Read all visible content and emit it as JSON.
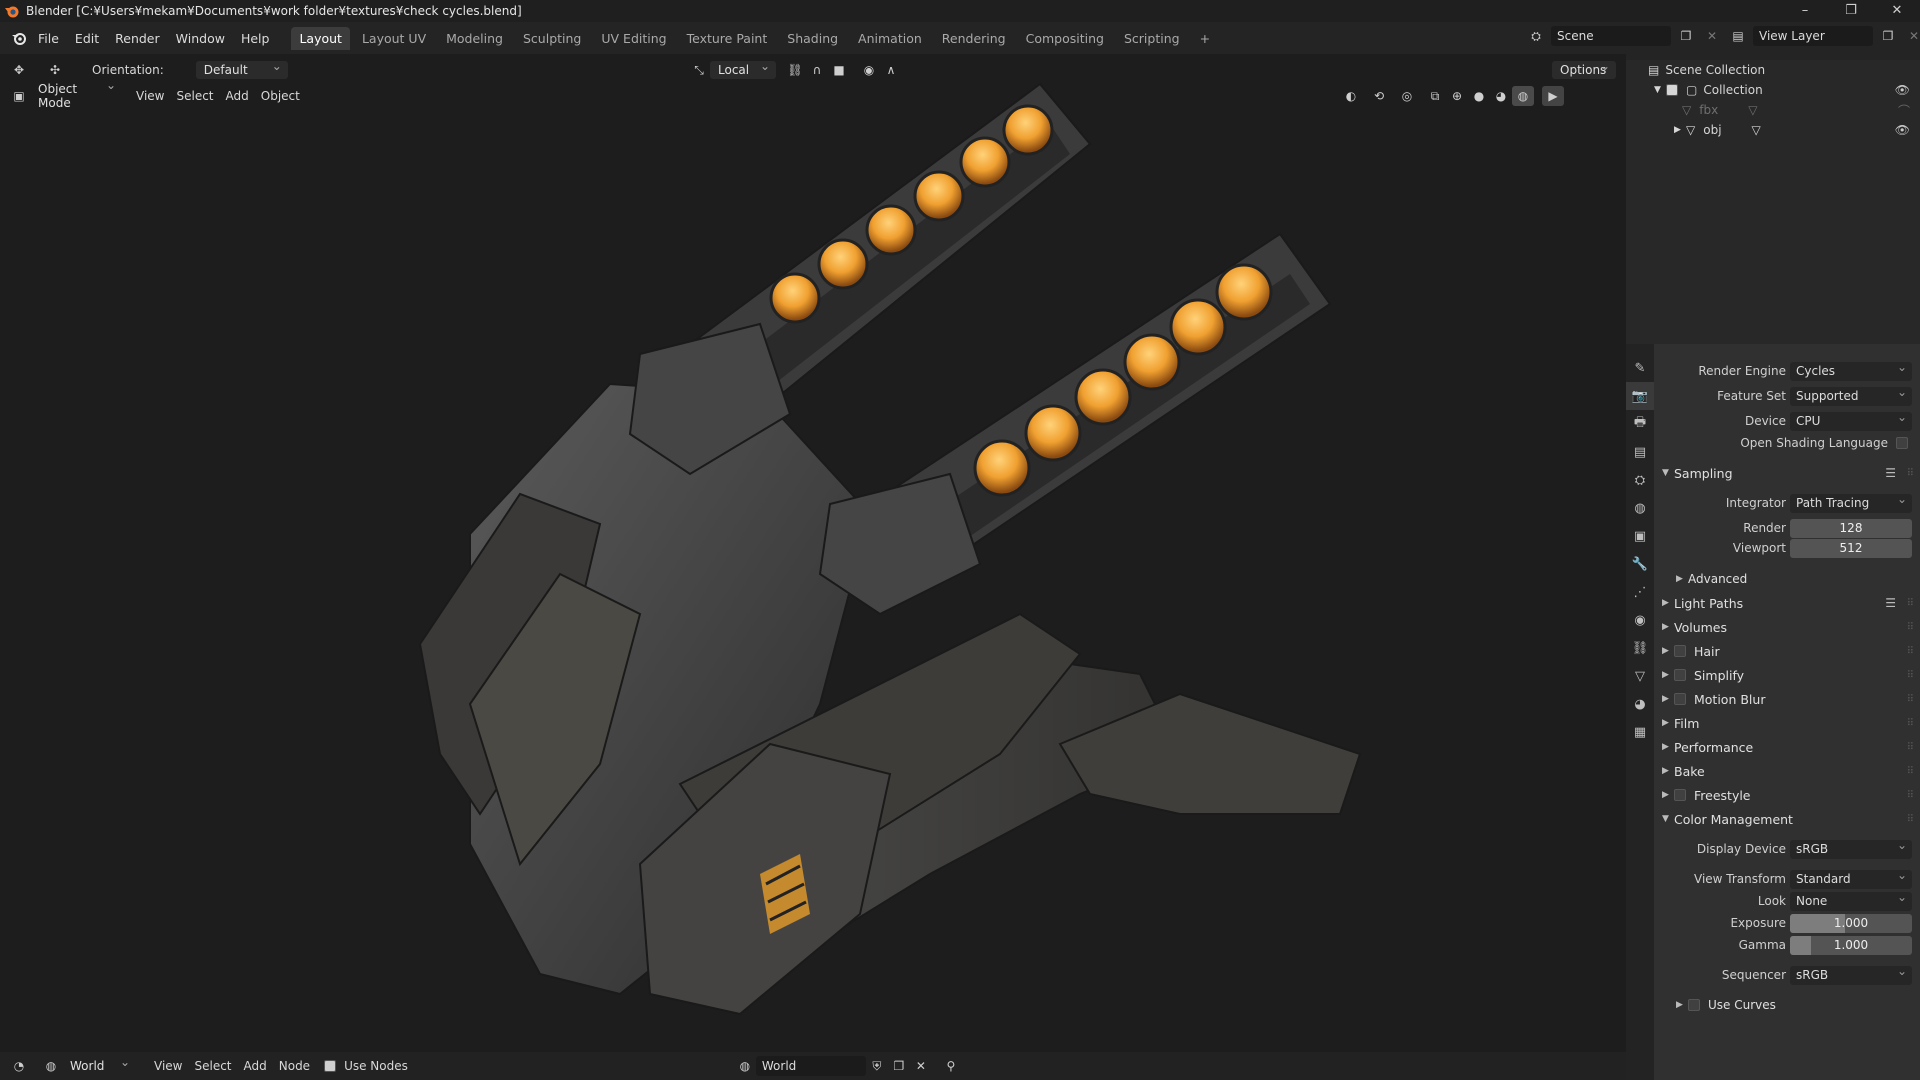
{
  "window": {
    "title": "Blender [C:¥Users¥mekam¥Documents¥work folder¥textures¥check cycles.blend]",
    "controls": [
      "–",
      "❐",
      "✕"
    ]
  },
  "menu": [
    "File",
    "Edit",
    "Render",
    "Window",
    "Help"
  ],
  "workspaces": [
    "Layout",
    "Layout UV",
    "Modeling",
    "Sculpting",
    "UV Editing",
    "Texture Paint",
    "Shading",
    "Animation",
    "Rendering",
    "Compositing",
    "Scripting",
    "+"
  ],
  "active_workspace": "Layout",
  "scene": {
    "name": "Scene",
    "view_layer": "View Layer"
  },
  "viewport_header": {
    "orientation_label": "Orientation:",
    "orientation_value": "Default",
    "pivot_value": "Local",
    "options": "Options",
    "mode": "Object Mode",
    "menus": [
      "View",
      "Select",
      "Add",
      "Object"
    ]
  },
  "outliner": {
    "root": "Scene Collection",
    "collection": "Collection",
    "items": [
      "fbx",
      "obj"
    ]
  },
  "properties": {
    "render_engine_label": "Render Engine",
    "render_engine": "Cycles",
    "feature_set_label": "Feature Set",
    "feature_set": "Supported",
    "device_label": "Device",
    "device": "CPU",
    "osl_label": "Open Shading Language",
    "sampling": "Sampling",
    "integrator_label": "Integrator",
    "integrator": "Path Tracing",
    "render_label": "Render",
    "render_samples": "128",
    "viewport_label": "Viewport",
    "viewport_samples": "512",
    "advanced": "Advanced",
    "sections": [
      "Light Paths",
      "Volumes",
      "Hair",
      "Simplify",
      "Motion Blur",
      "Film",
      "Performance",
      "Bake",
      "Freestyle",
      "Color Management"
    ],
    "display_device_label": "Display Device",
    "display_device": "sRGB",
    "view_transform_label": "View Transform",
    "view_transform": "Standard",
    "look_label": "Look",
    "look": "None",
    "exposure_label": "Exposure",
    "exposure": "1.000",
    "exposure_fill": 0.45,
    "gamma_label": "Gamma",
    "gamma": "1.000",
    "gamma_fill": 0.17,
    "sequencer_label": "Sequencer",
    "sequencer": "sRGB",
    "use_curves": "Use Curves"
  },
  "footer": {
    "world": "World",
    "menus": [
      "View",
      "Select",
      "Add",
      "Node"
    ],
    "use_nodes": "Use Nodes",
    "world_slot": "World"
  },
  "colors": {
    "accent_orange": "#f0a030",
    "panel_bg": "#303030",
    "viewport_bg": "#1d1d1d"
  }
}
